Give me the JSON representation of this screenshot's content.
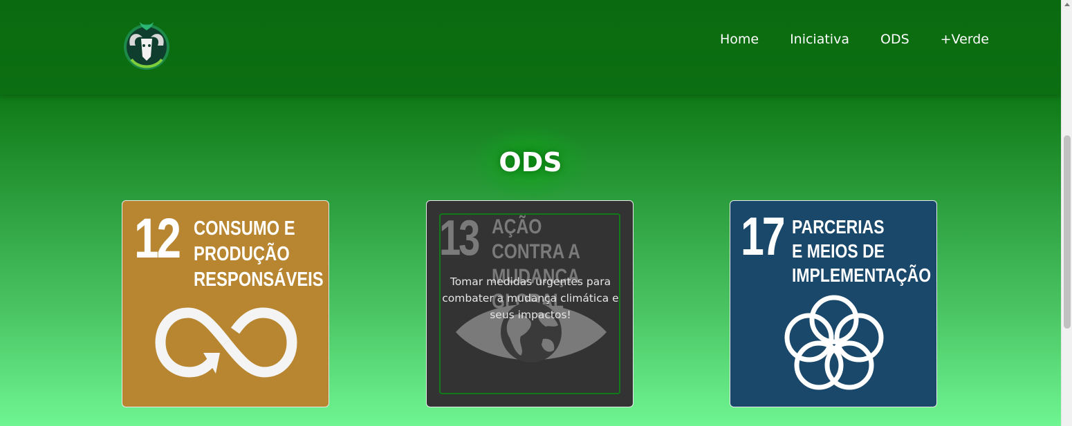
{
  "nav": {
    "logo_alt": "Logo carneiro verde",
    "items": [
      {
        "label": "Home"
      },
      {
        "label": "Iniciativa"
      },
      {
        "label": "ODS"
      },
      {
        "label": "+Verde"
      }
    ]
  },
  "section": {
    "title": "ODS"
  },
  "cards": [
    {
      "number": "12",
      "title": "CONSUMO E\nPRODUÇÃO\nRESPONSÁVEIS",
      "color": "#b88630",
      "icon": "infinity-arrow-icon"
    },
    {
      "number": "13",
      "title": "AÇÃO CONTRA A\nMUDANÇA GLOBAL\nDO CLIMA",
      "description": "Tomar medidas urgentes para combater a mudança climática e seus impactos!",
      "color": "#333333",
      "icon": "eye-globe-icon"
    },
    {
      "number": "17",
      "title": "PARCERIAS\nE MEIOS DE\nIMPLEMENTAÇÃO",
      "color": "#19486a",
      "icon": "interlocking-rings-icon"
    }
  ],
  "colors": {
    "header": "#0c6f12",
    "gradient_bottom": "#6ff592",
    "text": "#ffffff"
  }
}
